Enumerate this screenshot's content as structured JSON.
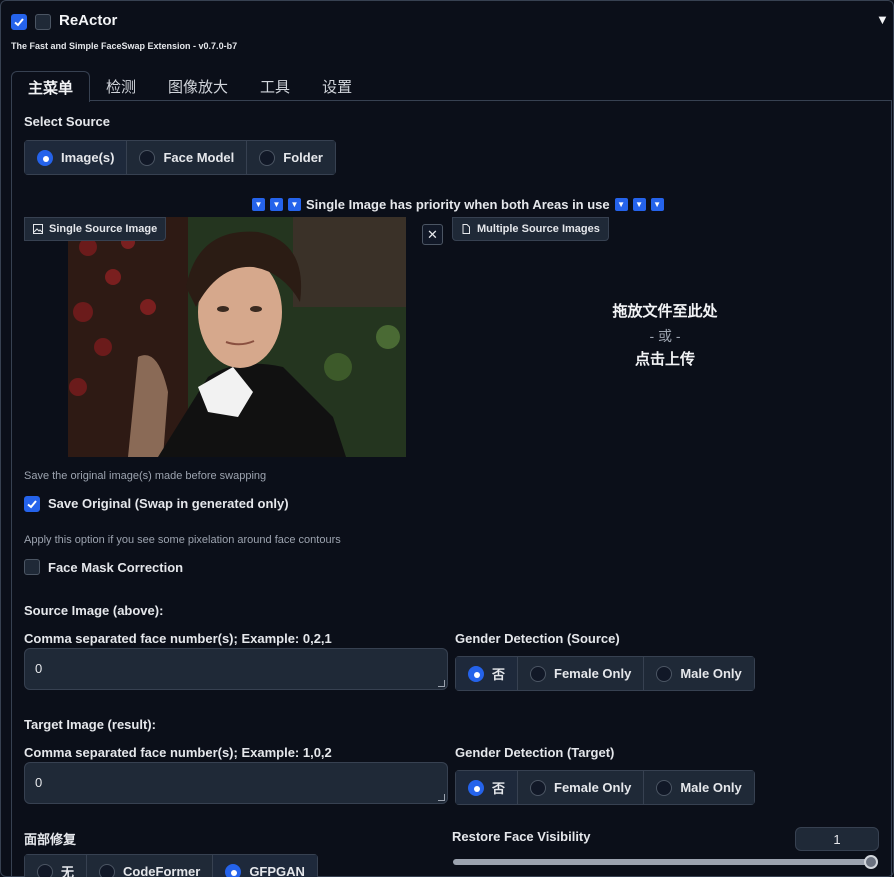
{
  "header": {
    "title": "ReActor",
    "subtitle": "The Fast and Simple FaceSwap Extension - v0.7.0-b7",
    "enabled": true
  },
  "tabs": [
    {
      "label": "主菜单",
      "active": true
    },
    {
      "label": "检测"
    },
    {
      "label": "图像放大"
    },
    {
      "label": "工具"
    },
    {
      "label": "设置"
    }
  ],
  "select_source": {
    "label": "Select Source",
    "options": [
      "Image(s)",
      "Face Model",
      "Folder"
    ],
    "selected": "Image(s)"
  },
  "priority_note": "Single Image has priority when both Areas in use",
  "single_source": {
    "label": "Single Source Image"
  },
  "multiple_source": {
    "label": "Multiple Source Images",
    "drop_line1": "拖放文件至此处",
    "drop_or": "- 或 -",
    "drop_line2": "点击上传"
  },
  "save_original": {
    "info": "Save the original image(s) made before swapping",
    "label": "Save Original (Swap in generated only)",
    "checked": true
  },
  "face_mask": {
    "info": "Apply this option if you see some pixelation around face contours",
    "label": "Face Mask Correction",
    "checked": false
  },
  "source_image": {
    "heading": "Source Image (above):",
    "faces_label": "Comma separated face number(s); Example: 0,2,1",
    "faces_value": "0",
    "gender_label": "Gender Detection (Source)",
    "gender_options": [
      "否",
      "Female Only",
      "Male Only"
    ],
    "gender_selected": "否"
  },
  "target_image": {
    "heading": "Target Image (result):",
    "faces_label": "Comma separated face number(s); Example: 1,0,2",
    "faces_value": "0",
    "gender_label": "Gender Detection (Target)",
    "gender_options": [
      "否",
      "Female Only",
      "Male Only"
    ],
    "gender_selected": "否"
  },
  "face_restore": {
    "label": "面部修复",
    "options": [
      "无",
      "CodeFormer",
      "GFPGAN"
    ],
    "selected": "GFPGAN"
  },
  "restore_visibility": {
    "label": "Restore Face Visibility",
    "value": "1"
  },
  "colors": {
    "accent": "#2563eb",
    "background": "#0b0f19",
    "panel": "#1f2937"
  }
}
